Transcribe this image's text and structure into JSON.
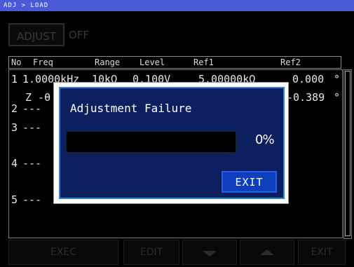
{
  "titlebar": {
    "breadcrumb": "ADJ > LOAD"
  },
  "adjust": {
    "button_label": "ADJUST",
    "state": "OFF"
  },
  "table": {
    "headers": [
      "No",
      "Freq",
      "Range",
      "Level",
      "Ref1",
      "Ref2"
    ],
    "rows": [
      {
        "no": "1",
        "freq": "1.0000kHz",
        "range": "10kΩ",
        "level": "0.100V",
        "ref1": "5.00000kΩ",
        "ref2": "0.000",
        "unit": "°"
      },
      {
        "sub": "Z -θ",
        "ref2": "-0.389",
        "unit": "°"
      },
      {
        "no": "2",
        "freq": "---"
      },
      {
        "no": "3",
        "freq": "---"
      },
      {
        "no": "4",
        "freq": "---"
      },
      {
        "no": "5",
        "freq": "---",
        "range": "---",
        "level": "---",
        "ref1": "---",
        "ref2": "---"
      }
    ]
  },
  "dialog": {
    "title": "Adjustment Failure",
    "progress": "0%",
    "progress_value": 0,
    "exit_label": "EXIT"
  },
  "bottom_bar": {
    "exec_label": "EXEC",
    "edit_label": "EDIT",
    "exit_label": "EXIT",
    "down_icon": "arrow-down-icon",
    "up_icon": "arrow-up-icon"
  },
  "colors": {
    "titlebar": "#4a5ad6",
    "dialog_bg": "#0c1f5f",
    "dialog_border": "#2f86c9",
    "exit_button": "#0f3fbf",
    "disabled_text": "#2c2c2c"
  }
}
